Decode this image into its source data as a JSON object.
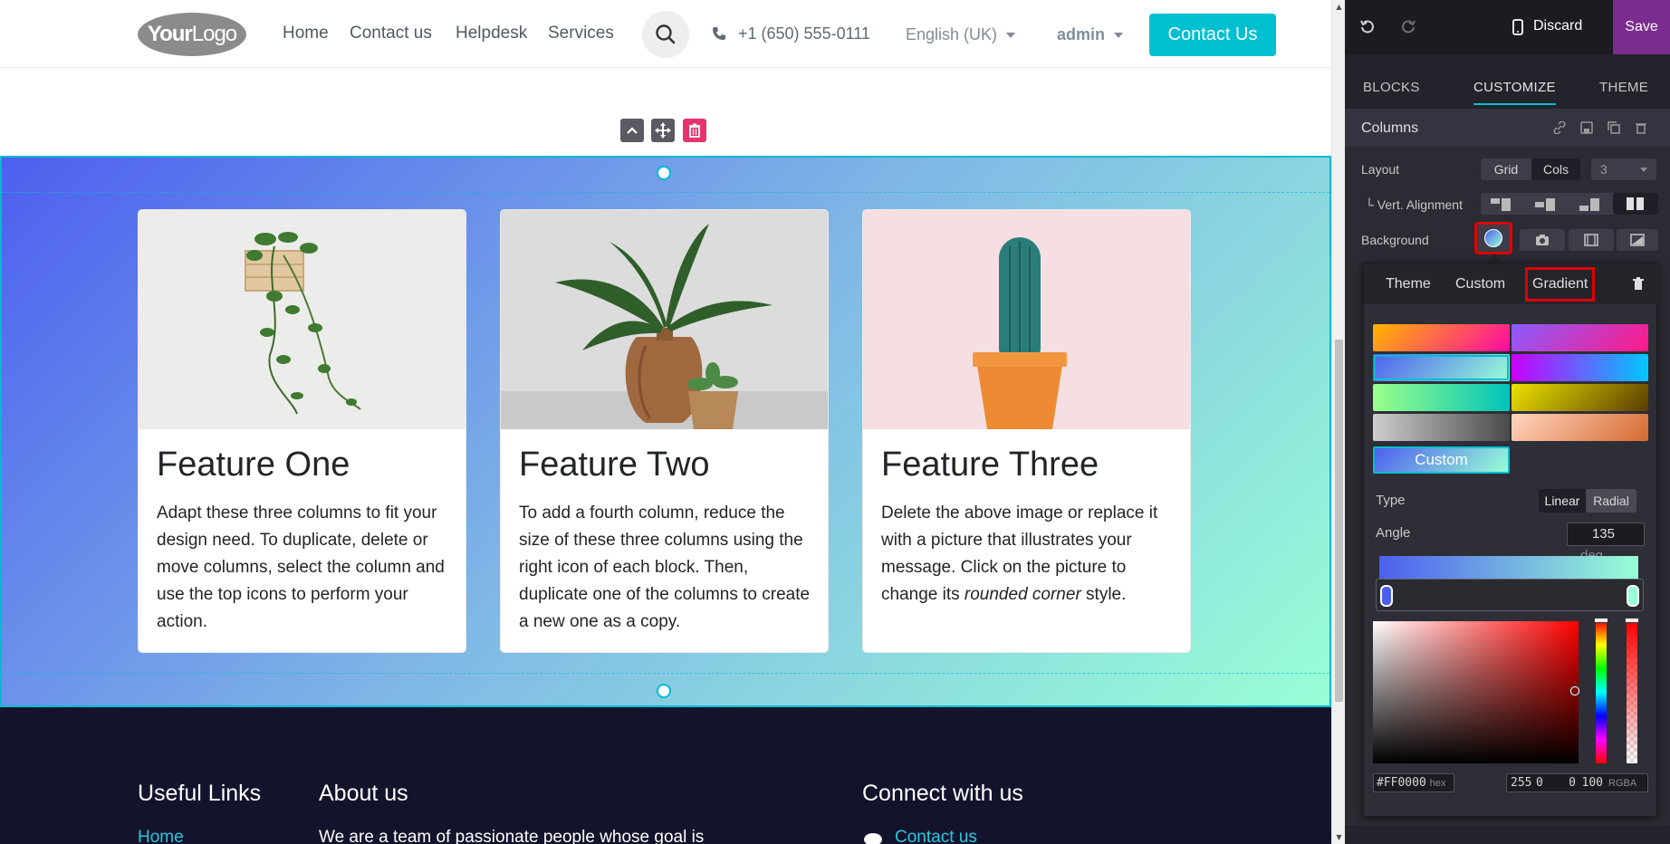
{
  "header": {
    "logo_text_bold": "Your",
    "logo_text": "Logo",
    "nav": [
      "Home",
      "Contact us",
      "Helpdesk",
      "Services"
    ],
    "phone": "+1 (650) 555-0111",
    "language": "English (UK)",
    "user": "admin",
    "cta": "Contact Us"
  },
  "features": [
    {
      "title": "Feature One",
      "text": "Adapt these three columns to fit your design need. To duplicate, delete or move columns, select the column and use the top icons to perform your action."
    },
    {
      "title": "Feature Two",
      "text": "To add a fourth column, reduce the size of these three columns using the right icon of each block. Then, duplicate one of the columns to create a new one as a copy."
    },
    {
      "title": "Feature Three",
      "text_before": "Delete the above image or replace it with a picture that illustrates your message. Click on the picture to change its ",
      "text_italic": "rounded corner",
      "text_after": " style."
    }
  ],
  "footer": {
    "useful_links": "Useful Links",
    "about": "About us",
    "connect": "Connect with us",
    "link_home": "Home",
    "about_text": "We are a team of passionate people whose goal is",
    "link_contact": "Contact us"
  },
  "editor": {
    "discard": "Discard",
    "save": "Save",
    "tabs": [
      "BLOCKS",
      "CUSTOMIZE",
      "THEME"
    ],
    "active_tab": "CUSTOMIZE",
    "snippet_name": "Columns",
    "layout_label": "Layout",
    "layout_options": [
      "Grid",
      "Cols"
    ],
    "cols_value": "3",
    "vert_alignment_label": "└ Vert. Alignment",
    "background_label": "Background",
    "color_tabs": [
      "Theme",
      "Custom",
      "Gradient"
    ],
    "active_color_tab": "Gradient",
    "custom_gradient_label": "Custom",
    "type_label": "Type",
    "type_options": [
      "Linear",
      "Radial"
    ],
    "angle_label": "Angle",
    "angle_value": "135",
    "angle_unit": "deg",
    "hex_value": "#FF0000",
    "hex_label": "hex",
    "rgba_values": [
      "255",
      "0",
      "0",
      "100"
    ],
    "rgba_label": "RGBA"
  },
  "colors": {
    "accent": "#00bcd4",
    "save": "#7b2c8f",
    "gradient_start": "#4d5fef",
    "gradient_end": "#98ffd6",
    "highlight": "#e00000"
  }
}
